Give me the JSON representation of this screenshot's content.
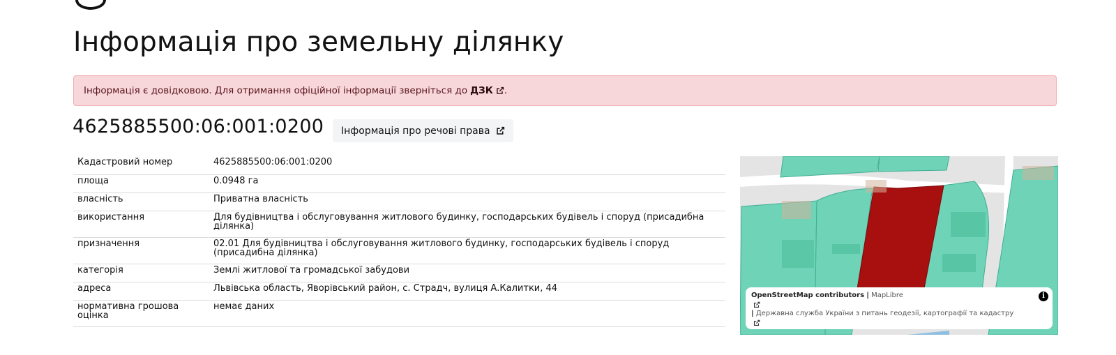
{
  "page_title": "Інформація про земельну ділянку",
  "alert": {
    "text": "Інформація є довідковою. Для отримання офіційної інформації зверніться до",
    "link_label": "ДЗК",
    "trailing": "."
  },
  "cadastral_number": "4625885500:06:001:0200",
  "rights_button_label": "Інформація про речові права",
  "table": {
    "rows": [
      {
        "key": "Кадастровий номер",
        "value": "4625885500:06:001:0200"
      },
      {
        "key": "площа",
        "value": "0.0948 га"
      },
      {
        "key": "власність",
        "value": "Приватна власність"
      },
      {
        "key": "використання",
        "value": "Для будівництва і обслуговування житлового будинку, господарських будівель і споруд (присадибна ділянка)"
      },
      {
        "key": "призначення",
        "value": "02.01 Для будівництва і обслуговування житлового будинку, господарських будівель і споруд (присадибна ділянка)"
      },
      {
        "key": "категорія",
        "value": "Землі житлової та громадської забудови"
      },
      {
        "key": "адреса",
        "value": "Львівська область, Яворівський район, с. Страдч, вулиця А.Калитки, 44"
      },
      {
        "key": "нормативна грошова оцінка",
        "value": "немає даних"
      }
    ]
  },
  "map": {
    "attribution": {
      "osm": "OpenStreetMap contributors",
      "separator": "|",
      "maplibre": "MapLibre",
      "agency": "Державна служба України з питань геодезії, картографії та кадастру"
    },
    "info_glyph": "i",
    "colors": {
      "parcel_fill": "#6fd3b7",
      "selected_parcel": "#a81010",
      "road": "#ffffff",
      "background": "#e4e4e4",
      "building": "#d2b59c"
    }
  },
  "colors": {
    "alert_bg": "#f8d7da",
    "alert_border": "#f1aeb5",
    "alert_text": "#58151c"
  },
  "icons": [
    "external-link-icon",
    "info-icon"
  ]
}
